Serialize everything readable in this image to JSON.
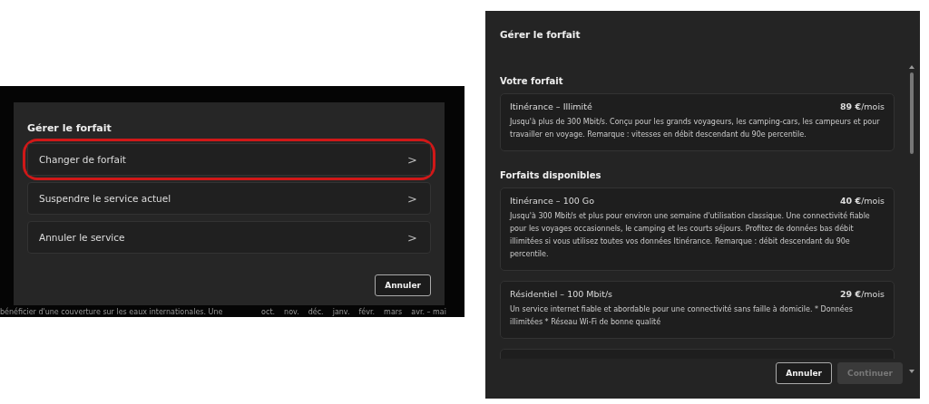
{
  "left_dialog": {
    "title": "Gérer le forfait",
    "items": [
      {
        "label": "Changer de forfait",
        "chevron": ">",
        "highlighted": true
      },
      {
        "label": "Suspendre le service actuel",
        "chevron": ">",
        "highlighted": false
      },
      {
        "label": "Annuler le service",
        "chevron": ">",
        "highlighted": false
      }
    ],
    "cancel_button": "Annuler",
    "background_text": [
      "bénéficier d'une couverture sur les eaux internationales. Une",
      "oct.",
      "nov.",
      "déc.",
      "janv.",
      "févr.",
      "mars",
      "avr. – mai"
    ]
  },
  "right_dialog": {
    "title": "Gérer le forfait",
    "sections": [
      {
        "heading": "Votre forfait",
        "plans": [
          {
            "name": "Itinérance – Illimité",
            "price": "**89 €**/mois",
            "description": "Jusqu'à plus de 300 Mbit/s. Conçu pour les grands voyageurs, les camping-cars, les campeurs et pour travailler en voyage. Remarque : vitesses en débit descendant du 90e percentile."
          }
        ]
      },
      {
        "heading": "Forfaits disponibles",
        "plans": [
          {
            "name": "Itinérance – 100 Go",
            "price": "**40 €**/mois",
            "description": "Jusqu'à 300 Mbit/s et plus pour environ une semaine d'utilisation classique. Une connectivité fiable pour les voyages occasionnels, le camping et les courts séjours. Profitez de données bas débit illimitées si vous utilisez toutes vos données Itinérance. Remarque : débit descendant du 90e percentile."
          },
          {
            "name": "Résidentiel – 100 Mbit/s",
            "price": "**29 €**/mois",
            "description": "Un service internet fiable et abordable pour une connectivité sans faille à domicile. * Données illimitées * Réseau Wi-Fi de bonne qualité"
          }
        ]
      }
    ],
    "buttons": [
      {
        "label": "Annuler",
        "disabled": false
      },
      {
        "label": "Continuer",
        "disabled": true
      }
    ]
  }
}
